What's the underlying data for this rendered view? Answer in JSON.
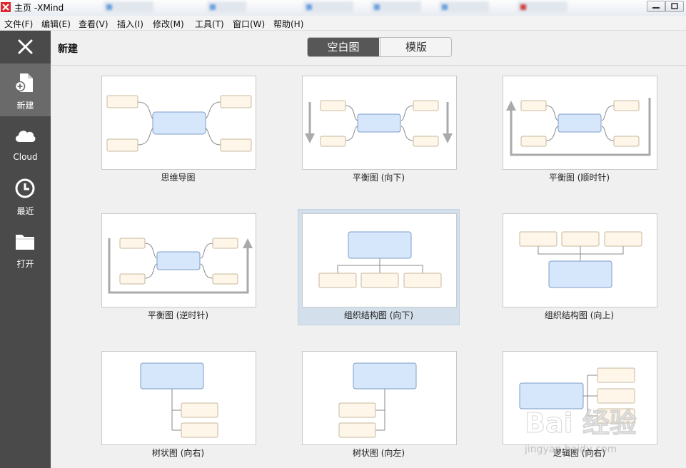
{
  "window": {
    "title": "主页 -XMind"
  },
  "menu": [
    "文件(F)",
    "编辑(E)",
    "查看(V)",
    "插入(I)",
    "修改(M)",
    "工具(T)",
    "窗口(W)",
    "帮助(H)"
  ],
  "sidebar": {
    "items": [
      {
        "label": "新建",
        "icon": "new-file-icon"
      },
      {
        "label": "Cloud",
        "icon": "cloud-icon"
      },
      {
        "label": "最近",
        "icon": "clock-icon"
      },
      {
        "label": "打开",
        "icon": "folder-icon"
      }
    ]
  },
  "header": {
    "title": "新建",
    "tabs": [
      {
        "label": "空白图",
        "selected": true
      },
      {
        "label": "模版",
        "selected": false
      }
    ]
  },
  "templates": [
    {
      "label": "思维导图",
      "kind": "mindmap"
    },
    {
      "label": "平衡图 (向下)",
      "kind": "balance-down"
    },
    {
      "label": "平衡图 (顺时针)",
      "kind": "balance-clockwise"
    },
    {
      "label": "平衡图 (逆时针)",
      "kind": "balance-counterclockwise"
    },
    {
      "label": "组织结构图 (向下)",
      "kind": "org-down",
      "selected": true
    },
    {
      "label": "组织结构图 (向上)",
      "kind": "org-up"
    },
    {
      "label": "树状图 (向右)",
      "kind": "tree-right"
    },
    {
      "label": "树状图 (向左)",
      "kind": "tree-left"
    },
    {
      "label": "逻辑图 (向右)",
      "kind": "logic-right"
    }
  ],
  "colors": {
    "sidebar_bg": "#4a4a4a",
    "sidebar_active": "#6a6a6a",
    "central_topic_fill": "#d6e6fb",
    "central_topic_stroke": "#7f9fc8",
    "sub_topic_fill": "#fdf6e9",
    "sub_topic_stroke": "#c8b89c",
    "selection": "#d3dfea"
  },
  "watermark": {
    "text": "Bai 经验",
    "url": "jingyan.baidu.com"
  }
}
